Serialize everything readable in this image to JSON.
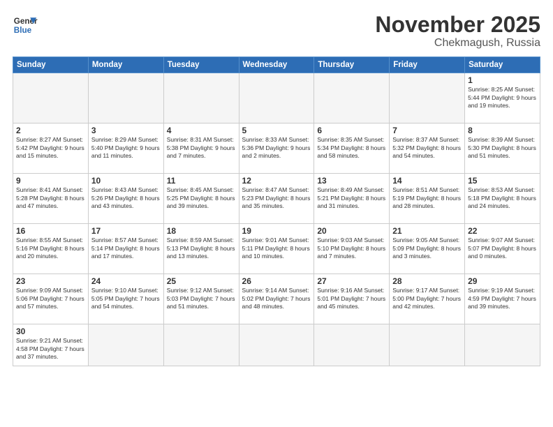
{
  "header": {
    "logo_general": "General",
    "logo_blue": "Blue",
    "month_title": "November 2025",
    "location": "Chekmagush, Russia"
  },
  "weekdays": [
    "Sunday",
    "Monday",
    "Tuesday",
    "Wednesday",
    "Thursday",
    "Friday",
    "Saturday"
  ],
  "days": [
    {
      "num": "",
      "info": ""
    },
    {
      "num": "",
      "info": ""
    },
    {
      "num": "",
      "info": ""
    },
    {
      "num": "",
      "info": ""
    },
    {
      "num": "",
      "info": ""
    },
    {
      "num": "",
      "info": ""
    },
    {
      "num": "1",
      "info": "Sunrise: 8:25 AM\nSunset: 5:44 PM\nDaylight: 9 hours\nand 19 minutes."
    },
    {
      "num": "2",
      "info": "Sunrise: 8:27 AM\nSunset: 5:42 PM\nDaylight: 9 hours\nand 15 minutes."
    },
    {
      "num": "3",
      "info": "Sunrise: 8:29 AM\nSunset: 5:40 PM\nDaylight: 9 hours\nand 11 minutes."
    },
    {
      "num": "4",
      "info": "Sunrise: 8:31 AM\nSunset: 5:38 PM\nDaylight: 9 hours\nand 7 minutes."
    },
    {
      "num": "5",
      "info": "Sunrise: 8:33 AM\nSunset: 5:36 PM\nDaylight: 9 hours\nand 2 minutes."
    },
    {
      "num": "6",
      "info": "Sunrise: 8:35 AM\nSunset: 5:34 PM\nDaylight: 8 hours\nand 58 minutes."
    },
    {
      "num": "7",
      "info": "Sunrise: 8:37 AM\nSunset: 5:32 PM\nDaylight: 8 hours\nand 54 minutes."
    },
    {
      "num": "8",
      "info": "Sunrise: 8:39 AM\nSunset: 5:30 PM\nDaylight: 8 hours\nand 51 minutes."
    },
    {
      "num": "9",
      "info": "Sunrise: 8:41 AM\nSunset: 5:28 PM\nDaylight: 8 hours\nand 47 minutes."
    },
    {
      "num": "10",
      "info": "Sunrise: 8:43 AM\nSunset: 5:26 PM\nDaylight: 8 hours\nand 43 minutes."
    },
    {
      "num": "11",
      "info": "Sunrise: 8:45 AM\nSunset: 5:25 PM\nDaylight: 8 hours\nand 39 minutes."
    },
    {
      "num": "12",
      "info": "Sunrise: 8:47 AM\nSunset: 5:23 PM\nDaylight: 8 hours\nand 35 minutes."
    },
    {
      "num": "13",
      "info": "Sunrise: 8:49 AM\nSunset: 5:21 PM\nDaylight: 8 hours\nand 31 minutes."
    },
    {
      "num": "14",
      "info": "Sunrise: 8:51 AM\nSunset: 5:19 PM\nDaylight: 8 hours\nand 28 minutes."
    },
    {
      "num": "15",
      "info": "Sunrise: 8:53 AM\nSunset: 5:18 PM\nDaylight: 8 hours\nand 24 minutes."
    },
    {
      "num": "16",
      "info": "Sunrise: 8:55 AM\nSunset: 5:16 PM\nDaylight: 8 hours\nand 20 minutes."
    },
    {
      "num": "17",
      "info": "Sunrise: 8:57 AM\nSunset: 5:14 PM\nDaylight: 8 hours\nand 17 minutes."
    },
    {
      "num": "18",
      "info": "Sunrise: 8:59 AM\nSunset: 5:13 PM\nDaylight: 8 hours\nand 13 minutes."
    },
    {
      "num": "19",
      "info": "Sunrise: 9:01 AM\nSunset: 5:11 PM\nDaylight: 8 hours\nand 10 minutes."
    },
    {
      "num": "20",
      "info": "Sunrise: 9:03 AM\nSunset: 5:10 PM\nDaylight: 8 hours\nand 7 minutes."
    },
    {
      "num": "21",
      "info": "Sunrise: 9:05 AM\nSunset: 5:09 PM\nDaylight: 8 hours\nand 3 minutes."
    },
    {
      "num": "22",
      "info": "Sunrise: 9:07 AM\nSunset: 5:07 PM\nDaylight: 8 hours\nand 0 minutes."
    },
    {
      "num": "23",
      "info": "Sunrise: 9:09 AM\nSunset: 5:06 PM\nDaylight: 7 hours\nand 57 minutes."
    },
    {
      "num": "24",
      "info": "Sunrise: 9:10 AM\nSunset: 5:05 PM\nDaylight: 7 hours\nand 54 minutes."
    },
    {
      "num": "25",
      "info": "Sunrise: 9:12 AM\nSunset: 5:03 PM\nDaylight: 7 hours\nand 51 minutes."
    },
    {
      "num": "26",
      "info": "Sunrise: 9:14 AM\nSunset: 5:02 PM\nDaylight: 7 hours\nand 48 minutes."
    },
    {
      "num": "27",
      "info": "Sunrise: 9:16 AM\nSunset: 5:01 PM\nDaylight: 7 hours\nand 45 minutes."
    },
    {
      "num": "28",
      "info": "Sunrise: 9:17 AM\nSunset: 5:00 PM\nDaylight: 7 hours\nand 42 minutes."
    },
    {
      "num": "29",
      "info": "Sunrise: 9:19 AM\nSunset: 4:59 PM\nDaylight: 7 hours\nand 39 minutes."
    },
    {
      "num": "30",
      "info": "Sunrise: 9:21 AM\nSunset: 4:58 PM\nDaylight: 7 hours\nand 37 minutes."
    },
    {
      "num": "",
      "info": ""
    },
    {
      "num": "",
      "info": ""
    },
    {
      "num": "",
      "info": ""
    },
    {
      "num": "",
      "info": ""
    },
    {
      "num": "",
      "info": ""
    },
    {
      "num": "",
      "info": ""
    }
  ]
}
